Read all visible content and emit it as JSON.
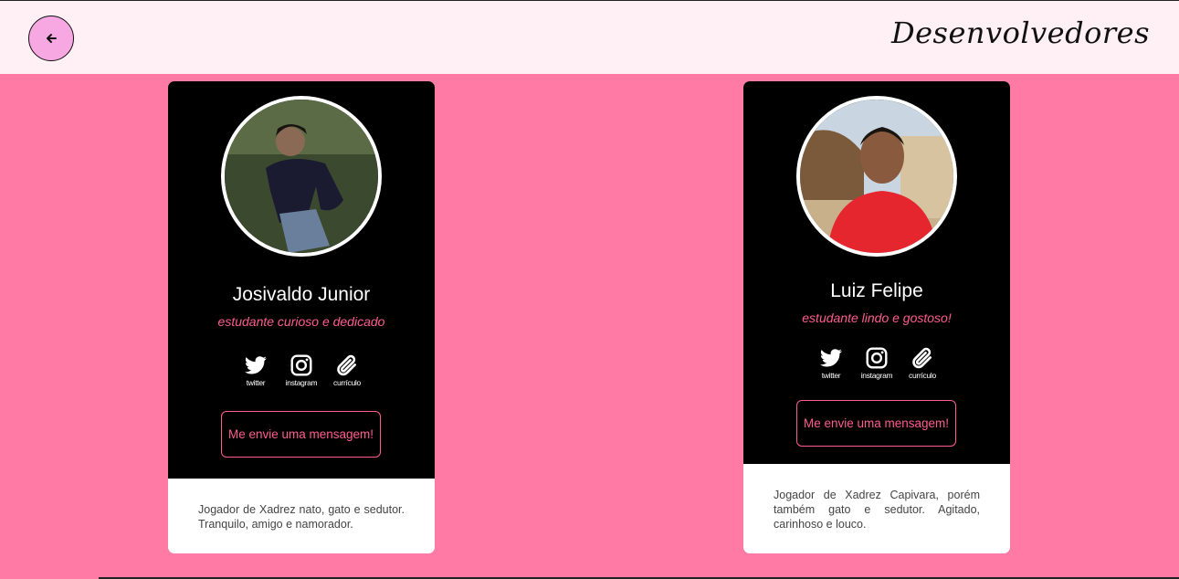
{
  "header": {
    "title": "Desenvolvedores",
    "back_icon": "arrow-left-icon"
  },
  "colors": {
    "background": "#ff7aa4",
    "header_bg": "#fff0f5",
    "accent": "#ff5c91",
    "back_button": "#f7a8e2"
  },
  "developers": [
    {
      "name": "Josivaldo Junior",
      "tagline": "estudante curioso e dedicado",
      "socials": [
        {
          "icon": "twitter-icon",
          "label": "twitter"
        },
        {
          "icon": "instagram-icon",
          "label": "instagram"
        },
        {
          "icon": "paperclip-icon",
          "label": "currículo"
        }
      ],
      "message_button": "Me envie uma mensagem!",
      "description": "Jogador de Xadrez nato, gato e sedutor. Tranquilo, amigo e namorador."
    },
    {
      "name": "Luiz Felipe",
      "tagline": "estudante lindo e gostoso!",
      "socials": [
        {
          "icon": "twitter-icon",
          "label": "twitter"
        },
        {
          "icon": "instagram-icon",
          "label": "instagram"
        },
        {
          "icon": "paperclip-icon",
          "label": "currículo"
        }
      ],
      "message_button": "Me envie uma mensagem!",
      "description": "Jogador de Xadrez Capivara, porém também gato e sedutor. Agitado, carinhoso e louco."
    }
  ]
}
